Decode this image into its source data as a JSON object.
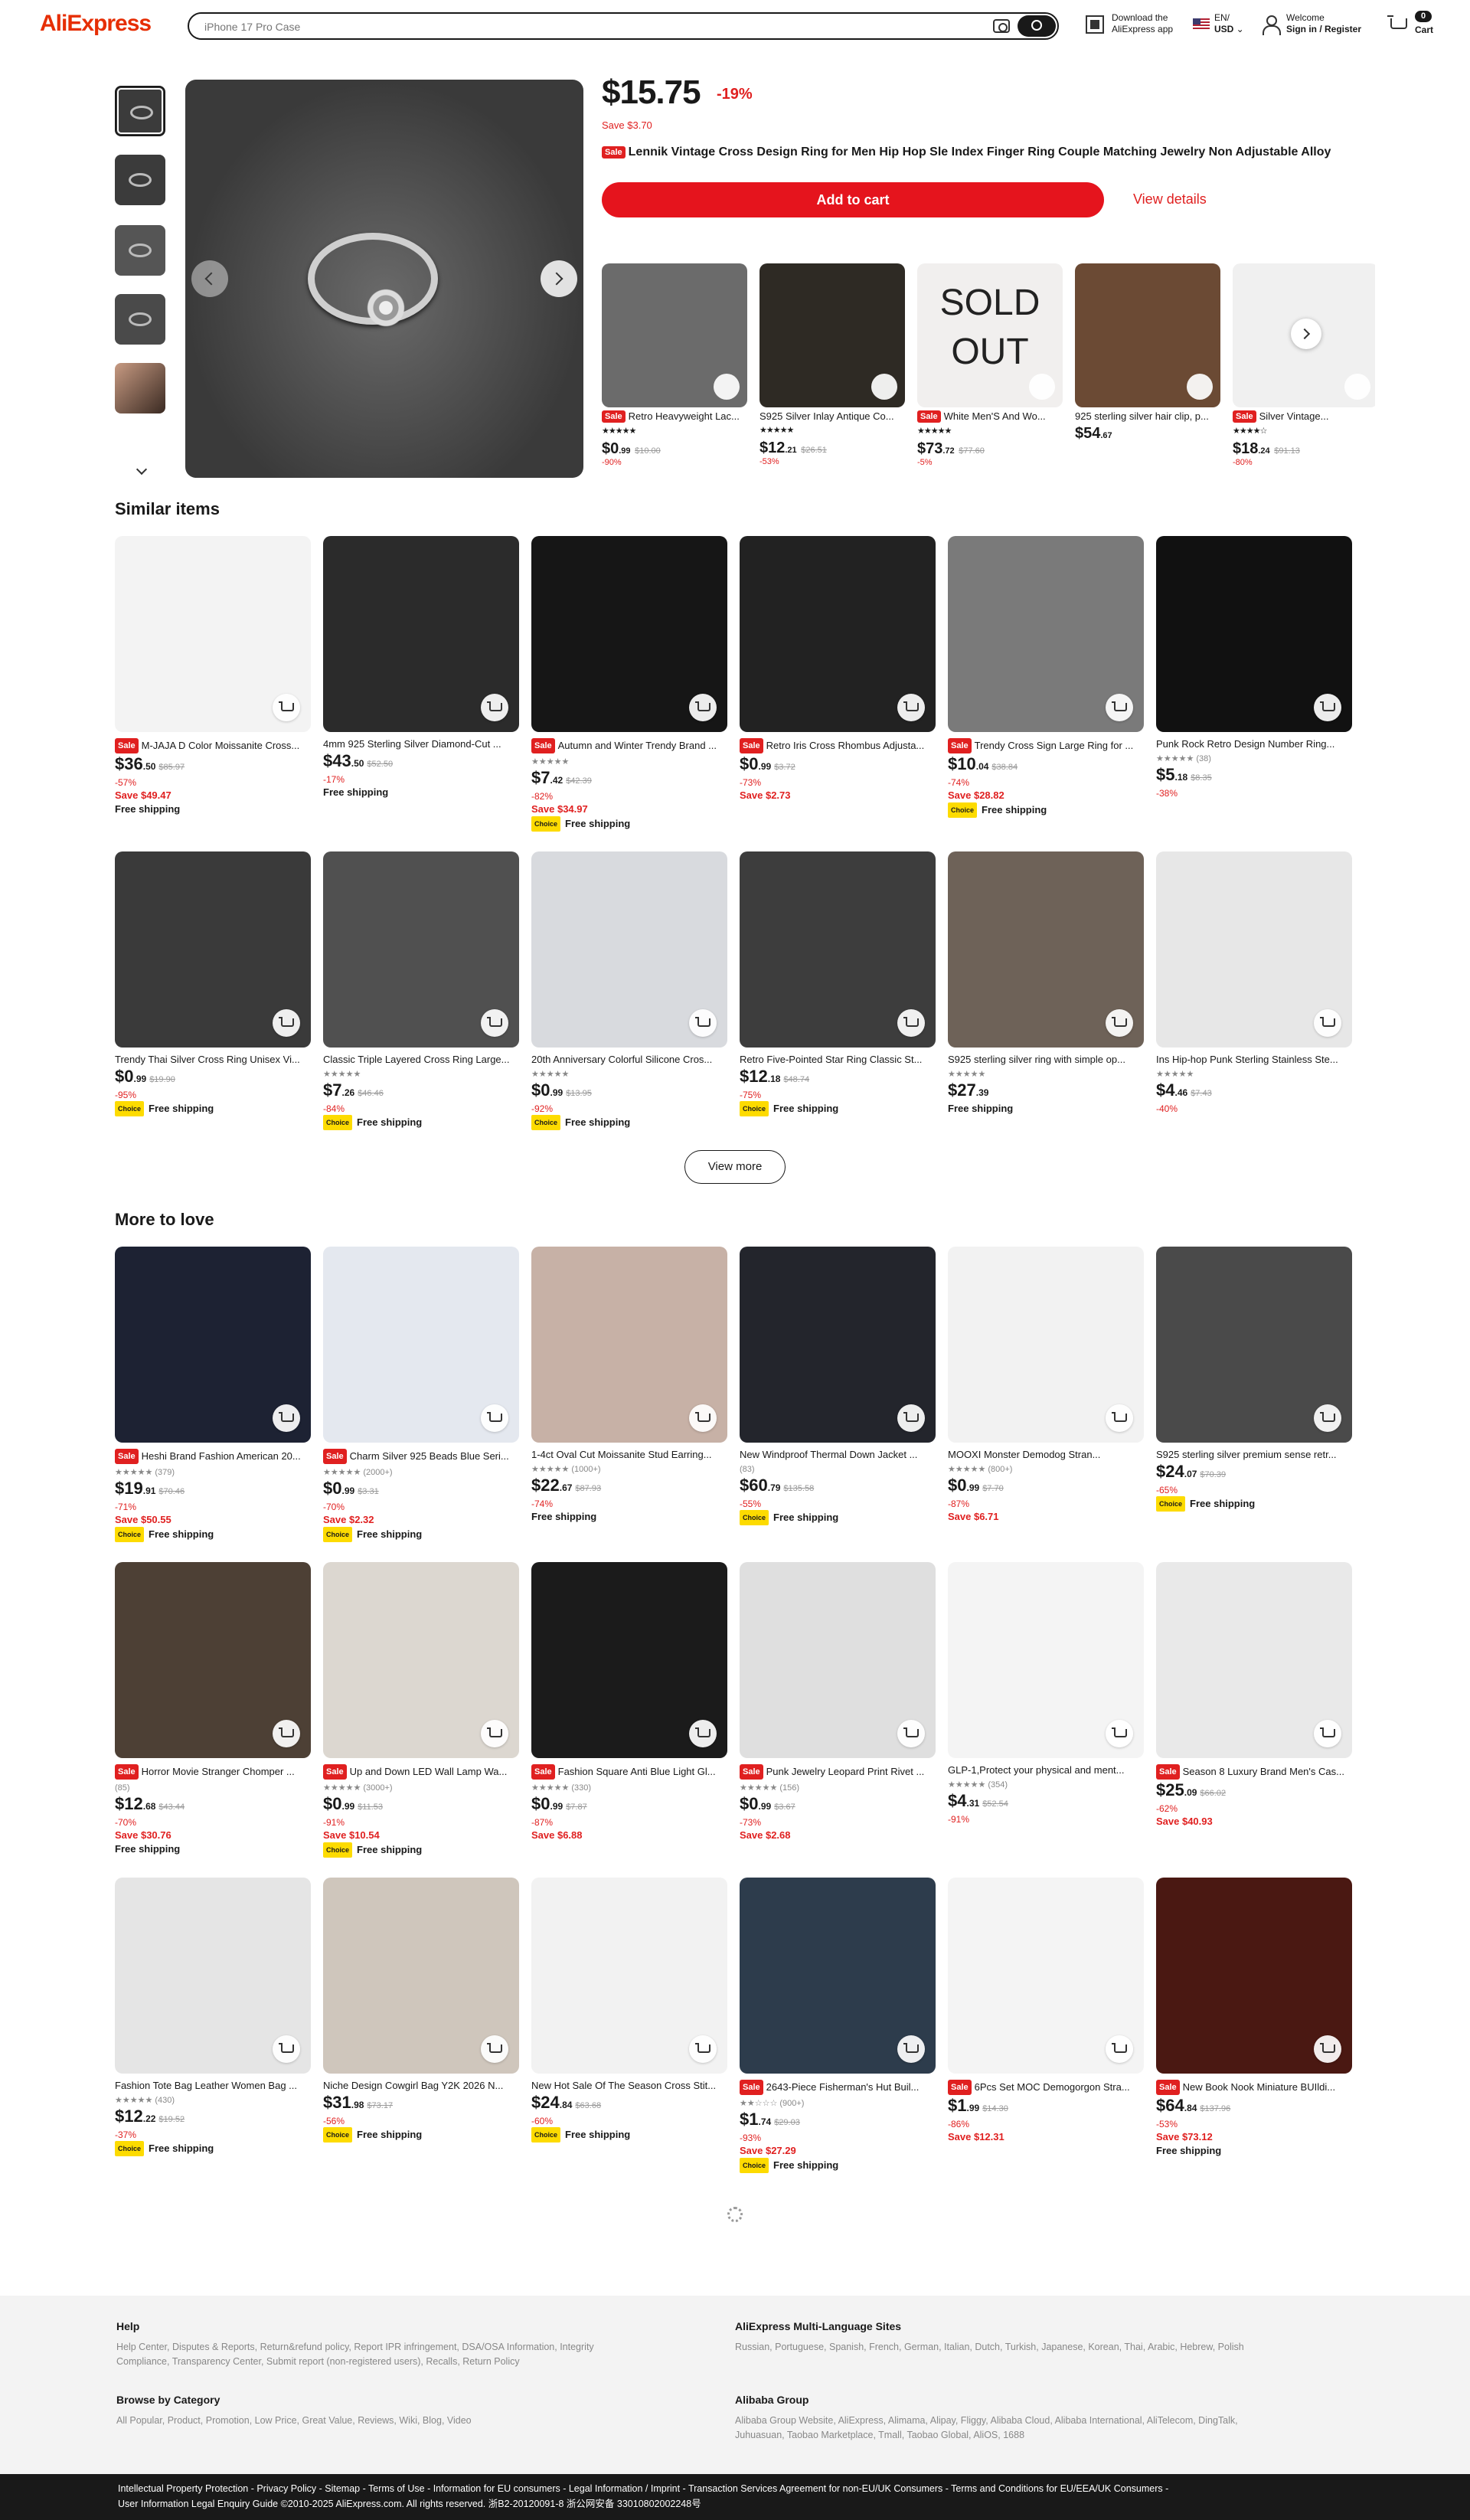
{
  "header": {
    "logo": "AliExpress",
    "search_placeholder": "iPhone 17 Pro Case",
    "download_l1": "Download the",
    "download_l2": "AliExpress app",
    "lang": "EN/",
    "currency": "USD",
    "welcome": "Welcome",
    "signin": "Sign in / Register",
    "cart_count": "0",
    "cart_label": "Cart"
  },
  "product": {
    "price": "$15.75",
    "discount": "-19%",
    "save": "Save $3.70",
    "sale_tag": "Sale",
    "title": "Lennik Vintage Cross Design Ring for Men Hip Hop Sle Index Finger Ring Couple Matching Jewelry Non Adjustable Alloy",
    "add_to_cart": "Add to cart",
    "view_details": "View details"
  },
  "recommend": [
    {
      "sale": "Sale",
      "title": "Retro Heavyweight Lac...",
      "stars": "★★★★★",
      "p_int": "0",
      "p_dec": ".99",
      "old": "$10.00",
      "disc": "-90%",
      "bg": "#6b6b6b"
    },
    {
      "sale": "",
      "title": "S925 Silver Inlay Antique Co...",
      "stars": "★★★★★",
      "p_int": "12",
      "p_dec": ".21",
      "old": "$26.51",
      "disc": "-53%",
      "bg": "#2e2a24"
    },
    {
      "sale": "Sale",
      "title": "White Men'S And Wo...",
      "stars": "★★★★★",
      "p_int": "73",
      "p_dec": ".72",
      "old": "$77.60",
      "disc": "-5%",
      "bg": "#f1efee",
      "sold": "SOLD OUT"
    },
    {
      "sale": "",
      "title": "925 sterling silver hair clip, p...",
      "stars": "",
      "p_int": "54",
      "p_dec": ".67",
      "old": "",
      "disc": "",
      "bg": "#6b4a34"
    },
    {
      "sale": "Sale",
      "title": "Silver Vintage...",
      "stars": "★★★★☆",
      "p_int": "18",
      "p_dec": ".24",
      "old": "$91.13",
      "disc": "-80%",
      "bg": "#f0f0f0"
    }
  ],
  "similar": {
    "title": "Similar items",
    "view_more": "View more",
    "items": [
      {
        "sale": "Sale",
        "title": "M-JAJA D Color Moissanite Cross...",
        "meta": "",
        "p_int": "36",
        "p_dec": ".50",
        "old": "$85.97",
        "disc": "-57%",
        "save": "Save $49.47",
        "choice": "",
        "ship": "Free shipping",
        "bg": "#f3f3f3"
      },
      {
        "sale": "",
        "title": "4mm 925 Sterling Silver Diamond-Cut ...",
        "meta": "",
        "p_int": "43",
        "p_dec": ".50",
        "old": "$52.50",
        "disc": "-17%",
        "save": "",
        "choice": "",
        "ship": "Free shipping",
        "bg": "#2b2b2b"
      },
      {
        "sale": "Sale",
        "title": "Autumn and Winter Trendy Brand ...",
        "meta": "★★★★★",
        "p_int": "7",
        "p_dec": ".42",
        "old": "$42.39",
        "disc": "-82%",
        "save": "Save $34.97",
        "choice": "Choice",
        "ship": "Free shipping",
        "bg": "#161616"
      },
      {
        "sale": "Sale",
        "title": "Retro Iris Cross Rhombus Adjusta...",
        "meta": "",
        "p_int": "0",
        "p_dec": ".99",
        "old": "$3.72",
        "disc": "-73%",
        "save": "Save $2.73",
        "choice": "",
        "ship": "",
        "bg": "#222"
      },
      {
        "sale": "Sale",
        "title": "Trendy Cross Sign Large Ring for ...",
        "meta": "",
        "p_int": "10",
        "p_dec": ".04",
        "old": "$38.84",
        "disc": "-74%",
        "save": "Save $28.82",
        "choice": "Choice",
        "ship": "Free shipping",
        "bg": "#7a7a7a"
      },
      {
        "sale": "",
        "title": "Punk Rock Retro Design Number Ring...",
        "meta": "★★★★★ (38)",
        "p_int": "5",
        "p_dec": ".18",
        "old": "$8.35",
        "disc": "-38%",
        "save": "",
        "choice": "",
        "ship": "",
        "bg": "#111"
      },
      {
        "sale": "",
        "title": "Trendy Thai Silver Cross Ring Unisex Vi...",
        "meta": "",
        "p_int": "0",
        "p_dec": ".99",
        "old": "$19.90",
        "disc": "-95%",
        "save": "",
        "choice": "Choice",
        "ship": "Free shipping",
        "bg": "#3a3a3a"
      },
      {
        "sale": "",
        "title": "Classic Triple Layered Cross Ring Large...",
        "meta": "★★★★★",
        "p_int": "7",
        "p_dec": ".26",
        "old": "$46.46",
        "disc": "-84%",
        "save": "",
        "choice": "Choice",
        "ship": "Free shipping",
        "bg": "#505050"
      },
      {
        "sale": "",
        "title": "20th Anniversary Colorful Silicone Cros...",
        "meta": "★★★★★",
        "p_int": "0",
        "p_dec": ".99",
        "old": "$13.95",
        "disc": "-92%",
        "save": "",
        "choice": "Choice",
        "ship": "Free shipping",
        "bg": "#d8dade"
      },
      {
        "sale": "",
        "title": "Retro Five-Pointed Star Ring Classic St...",
        "meta": "",
        "p_int": "12",
        "p_dec": ".18",
        "old": "$48.74",
        "disc": "-75%",
        "save": "",
        "choice": "Choice",
        "ship": "Free shipping",
        "bg": "#3d3d3d"
      },
      {
        "sale": "",
        "title": "S925 sterling silver ring with simple op...",
        "meta": "★★★★★",
        "p_int": "27",
        "p_dec": ".39",
        "old": "",
        "disc": "",
        "save": "",
        "choice": "",
        "ship": "Free shipping",
        "bg": "#6e6258"
      },
      {
        "sale": "",
        "title": "Ins Hip-hop Punk Sterling Stainless Ste...",
        "meta": "★★★★★",
        "p_int": "4",
        "p_dec": ".46",
        "old": "$7.43",
        "disc": "-40%",
        "save": "",
        "choice": "",
        "ship": "",
        "bg": "#e7e7e7"
      }
    ]
  },
  "more": {
    "title": "More to love",
    "items": [
      {
        "sale": "Sale",
        "title": "Heshi Brand Fashion American 20...",
        "meta": "★★★★★ (379)",
        "p_int": "19",
        "p_dec": ".91",
        "old": "$70.46",
        "disc": "-71%",
        "save": "Save $50.55",
        "choice": "Choice",
        "ship": "Free shipping",
        "bg": "#1d2233"
      },
      {
        "sale": "Sale",
        "title": "Charm Silver 925 Beads Blue Seri...",
        "meta": "★★★★★ (2000+)",
        "p_int": "0",
        "p_dec": ".99",
        "old": "$3.31",
        "disc": "-70%",
        "save": "Save $2.32",
        "choice": "Choice",
        "ship": "Free shipping",
        "bg": "#e4e8ef"
      },
      {
        "sale": "",
        "title": "1-4ct Oval Cut Moissanite Stud Earring...",
        "meta": "★★★★★ (1000+)",
        "p_int": "22",
        "p_dec": ".67",
        "old": "$87.93",
        "disc": "-74%",
        "save": "",
        "choice": "",
        "ship": "Free shipping",
        "bg": "#c7b1a6"
      },
      {
        "sale": "",
        "title": "New Windproof Thermal Down Jacket ...",
        "meta": "(83)",
        "p_int": "60",
        "p_dec": ".79",
        "old": "$135.58",
        "disc": "-55%",
        "save": "",
        "choice": "Choice",
        "ship": "Free shipping",
        "bg": "#23252c"
      },
      {
        "sale": "",
        "title": "MOOXI Monster Demodog Stran...",
        "meta": "★★★★★ (800+)",
        "p_int": "0",
        "p_dec": ".99",
        "old": "$7.70",
        "disc": "-87%",
        "save": "Save $6.71",
        "choice": "",
        "ship": "",
        "bg": "#f2f2f2"
      },
      {
        "sale": "",
        "title": "S925 sterling silver premium sense retr...",
        "meta": "",
        "p_int": "24",
        "p_dec": ".07",
        "old": "$70.39",
        "disc": "-65%",
        "save": "",
        "choice": "Choice",
        "ship": "Free shipping",
        "bg": "#4a4a4a"
      },
      {
        "sale": "Sale",
        "title": "Horror Movie Stranger Chomper ...",
        "meta": "(85)",
        "p_int": "12",
        "p_dec": ".68",
        "old": "$43.44",
        "disc": "-70%",
        "save": "Save $30.76",
        "choice": "",
        "ship": "Free shipping",
        "bg": "#4d4035"
      },
      {
        "sale": "Sale",
        "title": "Up and Down LED Wall Lamp Wa...",
        "meta": "★★★★★ (3000+)",
        "p_int": "0",
        "p_dec": ".99",
        "old": "$11.53",
        "disc": "-91%",
        "save": "Save $10.54",
        "choice": "Choice",
        "ship": "Free shipping",
        "bg": "#dcd7d0"
      },
      {
        "sale": "Sale",
        "title": "Fashion Square Anti Blue Light Gl...",
        "meta": "★★★★★ (330)",
        "p_int": "0",
        "p_dec": ".99",
        "old": "$7.87",
        "disc": "-87%",
        "save": "Save $6.88",
        "choice": "",
        "ship": "",
        "bg": "#1b1b1b"
      },
      {
        "sale": "Sale",
        "title": "Punk Jewelry Leopard Print Rivet ...",
        "meta": "★★★★★ (156)",
        "p_int": "0",
        "p_dec": ".99",
        "old": "$3.67",
        "disc": "-73%",
        "save": "Save $2.68",
        "choice": "",
        "ship": "",
        "bg": "#dfdfdf"
      },
      {
        "sale": "",
        "title": "GLP-1,Protect your physical and ment...",
        "meta": "★★★★★ (354)",
        "p_int": "4",
        "p_dec": ".31",
        "old": "$52.54",
        "disc": "-91%",
        "save": "",
        "choice": "",
        "ship": "",
        "bg": "#f4f4f4"
      },
      {
        "sale": "Sale",
        "title": "Season 8 Luxury Brand Men's Cas...",
        "meta": "",
        "p_int": "25",
        "p_dec": ".09",
        "old": "$66.02",
        "disc": "-62%",
        "save": "Save $40.93",
        "choice": "",
        "ship": "",
        "bg": "#e9e9e9"
      },
      {
        "sale": "",
        "title": "Fashion Tote Bag Leather Women Bag ...",
        "meta": "★★★★★ (430)",
        "p_int": "12",
        "p_dec": ".22",
        "old": "$19.52",
        "disc": "-37%",
        "save": "",
        "choice": "Choice",
        "ship": "Free shipping",
        "bg": "#e5e5e5"
      },
      {
        "sale": "",
        "title": "Niche Design Cowgirl Bag Y2K 2026 N...",
        "meta": "",
        "p_int": "31",
        "p_dec": ".98",
        "old": "$73.17",
        "disc": "-56%",
        "save": "",
        "choice": "Choice",
        "ship": "Free shipping",
        "bg": "#cfc6bc"
      },
      {
        "sale": "",
        "title": "New Hot Sale Of The Season Cross Stit...",
        "meta": "",
        "p_int": "24",
        "p_dec": ".84",
        "old": "$63.68",
        "disc": "-60%",
        "save": "",
        "choice": "Choice",
        "ship": "Free shipping",
        "bg": "#f2f2f2"
      },
      {
        "sale": "Sale",
        "title": "2643-Piece Fisherman's Hut Buil...",
        "meta": "★★☆☆☆ (900+)",
        "p_int": "1",
        "p_dec": ".74",
        "old": "$29.03",
        "disc": "-93%",
        "save": "Save $27.29",
        "choice": "Choice",
        "ship": "Free shipping",
        "bg": "#2d3c4c"
      },
      {
        "sale": "Sale",
        "title": "6Pcs Set MOC Demogorgon Stra...",
        "meta": "",
        "p_int": "1",
        "p_dec": ".99",
        "old": "$14.30",
        "disc": "-86%",
        "save": "Save $12.31",
        "choice": "",
        "ship": "",
        "bg": "#f4f4f4"
      },
      {
        "sale": "Sale",
        "title": "New Book Nook Miniature BUIldi...",
        "meta": "",
        "p_int": "64",
        "p_dec": ".84",
        "old": "$137.96",
        "disc": "-53%",
        "save": "Save $73.12",
        "choice": "",
        "ship": "Free shipping",
        "bg": "#4a1812"
      }
    ]
  },
  "footer": {
    "help_h": "Help",
    "help_1": "Help Center, Disputes & Reports, Return&refund policy, Report IPR infringement, DSA/OSA Information, Integrity",
    "help_2": "Compliance, Transparency Center, Submit report (non-registered users), Recalls, Return Policy",
    "multi_h": "AliExpress Multi-Language Sites",
    "multi_1": "Russian, Portuguese, Spanish, French, German, Italian, Dutch, Turkish, Japanese, Korean, Thai, Arabic, Hebrew, Polish",
    "browse_h": "Browse by Category",
    "browse_1": "All Popular, Product, Promotion, Low Price, Great Value, Reviews, Wiki, Blog, Video",
    "group_h": "Alibaba Group",
    "group_1": "Alibaba Group Website, AliExpress, Alimama, Alipay, Fliggy, Alibaba Cloud, Alibaba International, AliTelecom, DingTalk,",
    "group_2": "Juhuasuan, Taobao Marketplace, Tmall, Taobao Global, AliOS, 1688",
    "bottom_1": "Intellectual Property Protection  -  Privacy Policy  -  Sitemap  -  Terms of Use  -  Information for EU consumers  -  Legal Information / Imprint  -  Transaction Services Agreement for non-EU/UK Consumers  -  Terms and Conditions for EU/EEA/UK Consumers  -",
    "bottom_2": "User Information Legal Enquiry Guide  ©2010-2025 AliExpress.com. All rights reserved.   浙B2-20120091-8   浙公网安备 33010802002248号"
  }
}
